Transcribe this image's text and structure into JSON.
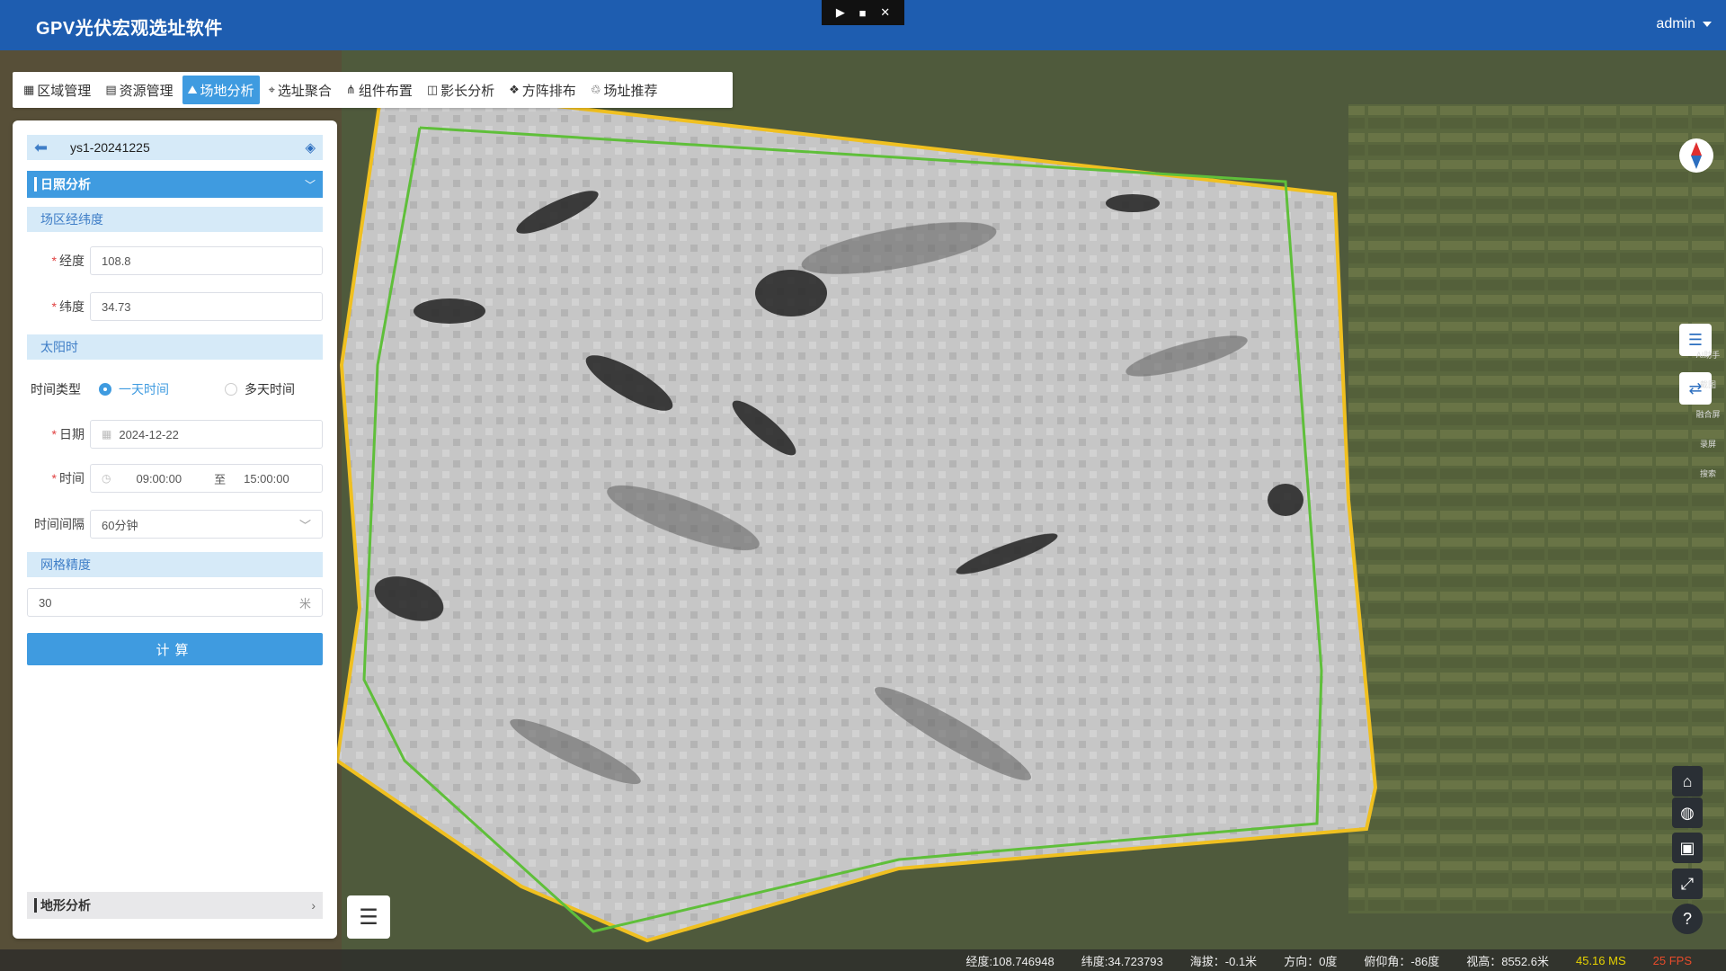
{
  "app": {
    "title": "GPV光伏宏观选址软件",
    "user": "admin"
  },
  "window_controls": [
    "▶",
    "■",
    "✕"
  ],
  "toolbar": {
    "items": [
      {
        "label": "区域管理",
        "icon": "map-icon",
        "glyph": "▦",
        "active": false
      },
      {
        "label": "资源管理",
        "icon": "print-icon",
        "glyph": "▤",
        "active": false
      },
      {
        "label": "场地分析",
        "icon": "mountain-icon",
        "glyph": "⛰",
        "active": true
      },
      {
        "label": "选址聚合",
        "icon": "location-pin-icon",
        "glyph": "⌖",
        "active": false
      },
      {
        "label": "组件布置",
        "icon": "nodes-icon",
        "glyph": "⋔",
        "active": false
      },
      {
        "label": "影长分析",
        "icon": "shadow-icon",
        "glyph": "◫",
        "active": false
      },
      {
        "label": "方阵排布",
        "icon": "array-icon",
        "glyph": "❖",
        "active": false
      },
      {
        "label": "场址推荐",
        "icon": "recommend-icon",
        "glyph": "♲",
        "active": false
      }
    ]
  },
  "panel": {
    "project_name": "ys1-20241225",
    "sunshine_section": "日照分析",
    "coords_section": "场区经纬度",
    "longitude_label": "经度",
    "longitude_value": "108.8",
    "latitude_label": "纬度",
    "latitude_value": "34.73",
    "solar_time_section": "太阳时",
    "time_type_label": "时间类型",
    "time_type_options": [
      "一天时间",
      "多天时间"
    ],
    "time_type_selected": "一天时间",
    "date_label": "日期",
    "date_value": "2024-12-22",
    "time_label": "时间",
    "time_start": "09:00:00",
    "time_separator": "至",
    "time_end": "15:00:00",
    "interval_label": "时间间隔",
    "interval_value": "60分钟",
    "grid_section": "网格精度",
    "grid_value": "30",
    "grid_unit": "米",
    "calc_button": "计算",
    "terrain_section": "地形分析"
  },
  "right_tools": {
    "mini_labels": [
      "AI助手",
      "截图",
      "融合屏",
      "录屏",
      "搜索"
    ]
  },
  "status": {
    "longitude": "经度:108.746948",
    "latitude": "纬度:34.723793",
    "altitude": "海拔：-0.1米",
    "heading": "方向：0度",
    "pitch": "俯仰角：-86度",
    "view_height": "视高：8552.6米",
    "ms": "45.16 MS",
    "fps": "25 FPS"
  },
  "colors": {
    "header_bg": "#1e5db0",
    "accent": "#3f9be0",
    "boundary_outer": "#f0c020",
    "boundary_inner": "#5fbf3a"
  }
}
